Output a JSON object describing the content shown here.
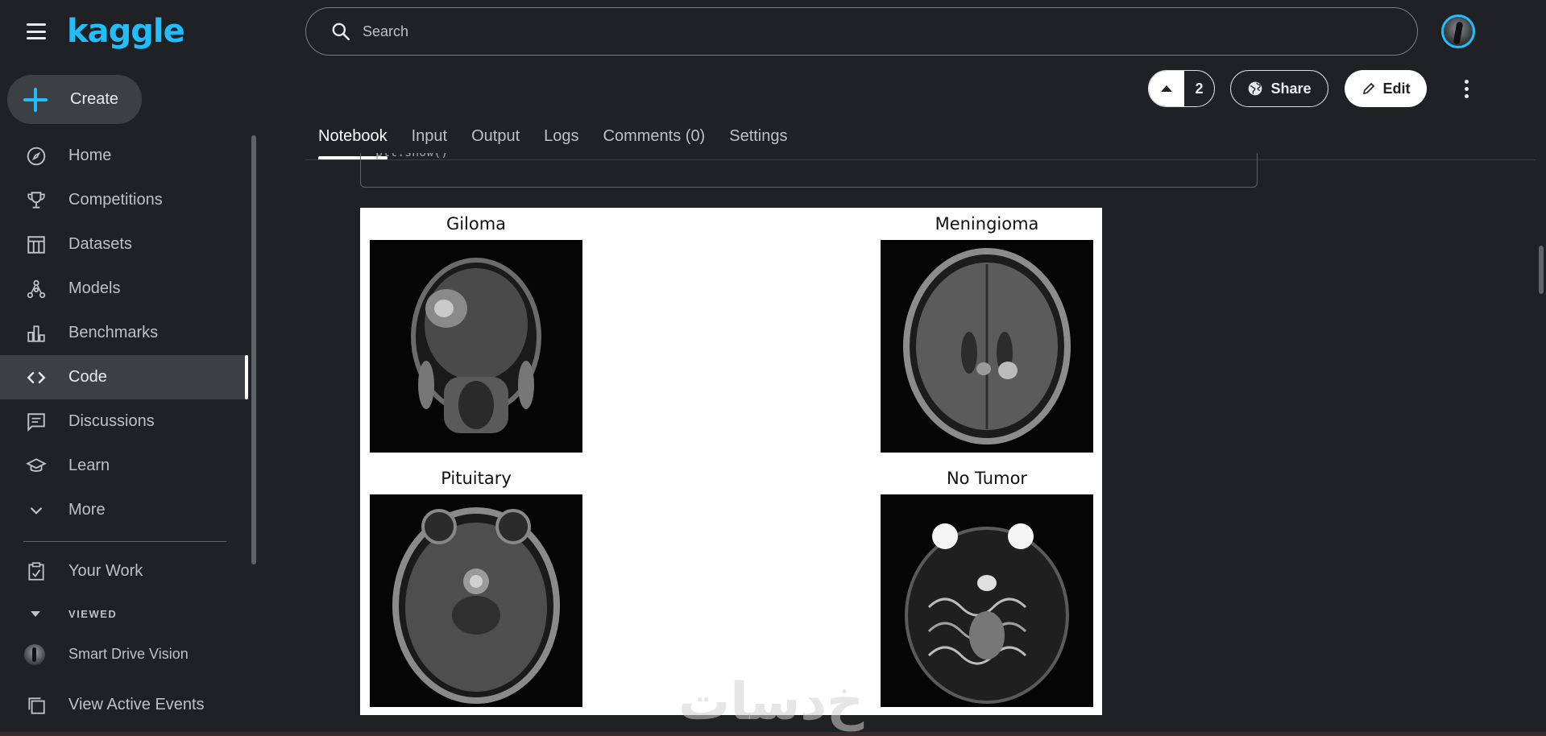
{
  "header": {
    "logo": "kaggle",
    "search_placeholder": "Search"
  },
  "sidebar": {
    "create_label": "Create",
    "items": [
      {
        "label": "Home",
        "icon": "compass-icon"
      },
      {
        "label": "Competitions",
        "icon": "trophy-icon"
      },
      {
        "label": "Datasets",
        "icon": "table-icon"
      },
      {
        "label": "Models",
        "icon": "models-icon"
      },
      {
        "label": "Benchmarks",
        "icon": "bar-chart-icon"
      },
      {
        "label": "Code",
        "icon": "code-icon",
        "active": true
      },
      {
        "label": "Discussions",
        "icon": "comment-icon"
      },
      {
        "label": "Learn",
        "icon": "school-icon"
      },
      {
        "label": "More",
        "icon": "chevron-down-icon"
      }
    ],
    "your_work": "Your Work",
    "viewed_label": "VIEWED",
    "viewed_items": [
      "Smart Drive Vision"
    ],
    "view_active_events": "View Active Events"
  },
  "actions": {
    "vote_count": "2",
    "share_label": "Share",
    "edit_label": "Edit"
  },
  "tabs": [
    "Notebook",
    "Input",
    "Output",
    "Logs",
    "Comments (0)",
    "Settings"
  ],
  "active_tab": "Notebook",
  "code_cell": {
    "text": "plt.show()"
  },
  "figure": {
    "panels": [
      "Giloma",
      "Meningioma",
      "Pituitary",
      "No Tumor"
    ]
  },
  "watermark": "خ‌دسات",
  "colors": {
    "background": "#202124",
    "accent": "#20beff",
    "active_nav": "#3c4043"
  }
}
